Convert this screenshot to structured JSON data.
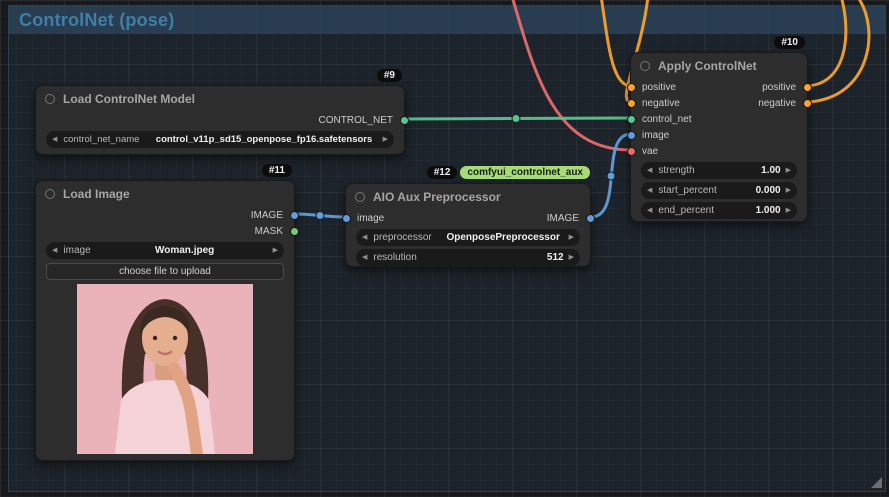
{
  "group": {
    "title": "ControlNet (pose)"
  },
  "ui": {
    "arrow_left": "◀",
    "arrow_right": "▶"
  },
  "colors": {
    "canvas_bg": "#17191d",
    "group_header": "#2c4258",
    "group_title": "#3f7fa6",
    "node_bg": "#2d2d2d",
    "badge_green": "#a8db78",
    "link_conditioning": "#f7a22e",
    "link_control_net": "#58c48f",
    "link_image": "#5f9ed9",
    "link_vae": "#e66b6b",
    "slot_mask": "#7bc47b",
    "photo_background": "#eab3ba"
  },
  "nodes": {
    "load_controlnet": {
      "badge": "#9",
      "title": "Load ControlNet Model",
      "outputs": [
        "CONTROL_NET"
      ],
      "widgets": [
        {
          "label": "control_net_name",
          "value": "control_v11p_sd15_openpose_fp16.safetensors"
        }
      ]
    },
    "load_image": {
      "badge": "#11",
      "title": "Load Image",
      "outputs": [
        "IMAGE",
        "MASK"
      ],
      "widgets": [
        {
          "label": "image",
          "value": "Woman.jpeg"
        }
      ],
      "upload_button": "choose file to upload"
    },
    "aio_aux_preprocessor": {
      "badge": "#12",
      "badge_pack": "comfyui_controlnet_aux",
      "title": "AIO Aux Preprocessor",
      "inputs": [
        "image"
      ],
      "outputs": [
        "IMAGE"
      ],
      "widgets": [
        {
          "label": "preprocessor",
          "value": "OpenposePreprocessor"
        },
        {
          "label": "resolution",
          "value": "512"
        }
      ]
    },
    "apply_controlnet": {
      "badge": "#10",
      "title": "Apply ControlNet",
      "inputs": [
        "positive",
        "negative",
        "control_net",
        "image",
        "vae"
      ],
      "outputs": [
        "positive",
        "negative"
      ],
      "widgets": [
        {
          "label": "strength",
          "value": "1.00"
        },
        {
          "label": "start_percent",
          "value": "0.000"
        },
        {
          "label": "end_percent",
          "value": "1.000"
        }
      ]
    }
  }
}
